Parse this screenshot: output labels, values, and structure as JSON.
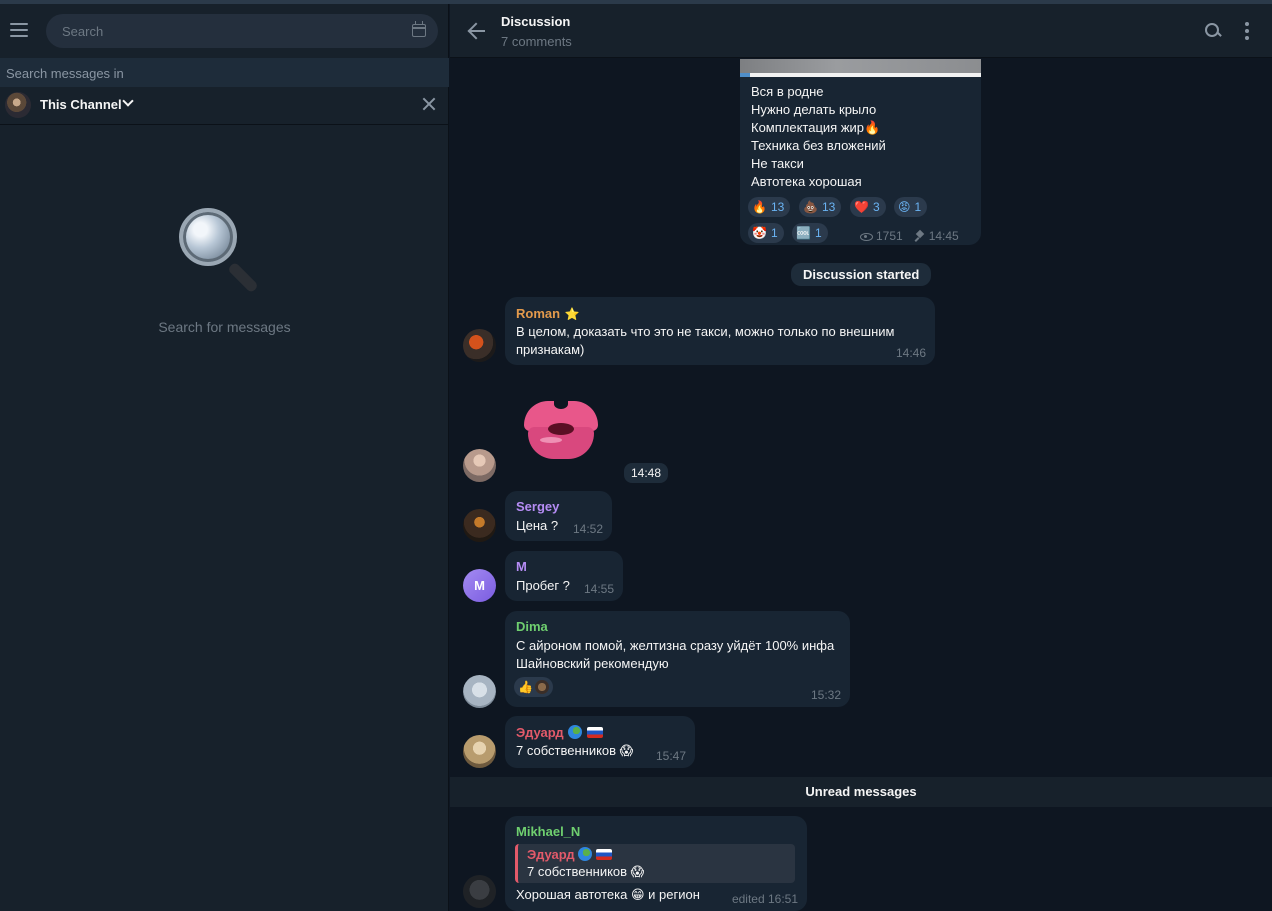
{
  "left": {
    "search_placeholder": "Search",
    "search_in_label": "Search messages in",
    "scope_label": "This Channel",
    "empty_text": "Search for messages"
  },
  "header": {
    "title": "Discussion",
    "subtitle": "7 comments"
  },
  "post": {
    "lines": [
      "Вся в родне",
      "Нужно делать крыло",
      "Комплектация жир🔥",
      "Техника без вложений",
      "Не такси",
      "Автотека хорошая"
    ],
    "reactions": [
      {
        "emoji": "🔥",
        "count": "13"
      },
      {
        "emoji": "💩",
        "count": "13"
      },
      {
        "emoji": "❤️",
        "count": "3"
      },
      {
        "emoji": "😡",
        "count": "1"
      },
      {
        "emoji": "🤡",
        "count": "1"
      },
      {
        "emoji": "🆒",
        "count": "1"
      }
    ],
    "views": "1751",
    "time": "14:45"
  },
  "service": {
    "discussion_started": "Discussion started",
    "unread_messages": "Unread messages"
  },
  "messages": [
    {
      "sender": "Roman",
      "sender_badge": "⭐",
      "text_line1": "В целом, доказать что это не такси, можно только по внешним",
      "text_line2": "признакам)",
      "time": "14:46",
      "color": "#e39a4c"
    },
    {
      "sticker": "kiss-lips",
      "time": "14:48"
    },
    {
      "sender": "Sergey",
      "text": "Цена ?",
      "time": "14:52",
      "color": "#b58cf4"
    },
    {
      "sender": "M",
      "avatar_letter": "M",
      "text": "Пробег ?",
      "time": "14:55",
      "color": "#b58cf4"
    },
    {
      "sender": "Dima",
      "text_line1": "С айроном помой, желтизна сразу уйдёт 100% инфа",
      "text_line2": "Шайновский рекомендую",
      "reaction": "👍",
      "time": "15:32",
      "color": "#6fcf6f"
    },
    {
      "sender": "Эдуард",
      "text": "7 собственников 😱",
      "time": "15:47",
      "color": "#e35a6a"
    },
    {
      "sender": "Mikhael_N",
      "reply_to_name": "Эдуард",
      "reply_to_text": "7 собственников 😱",
      "text": "Хорошая автотека 😁 и регион",
      "time": "edited 16:51",
      "color": "#6fcf6f"
    }
  ]
}
